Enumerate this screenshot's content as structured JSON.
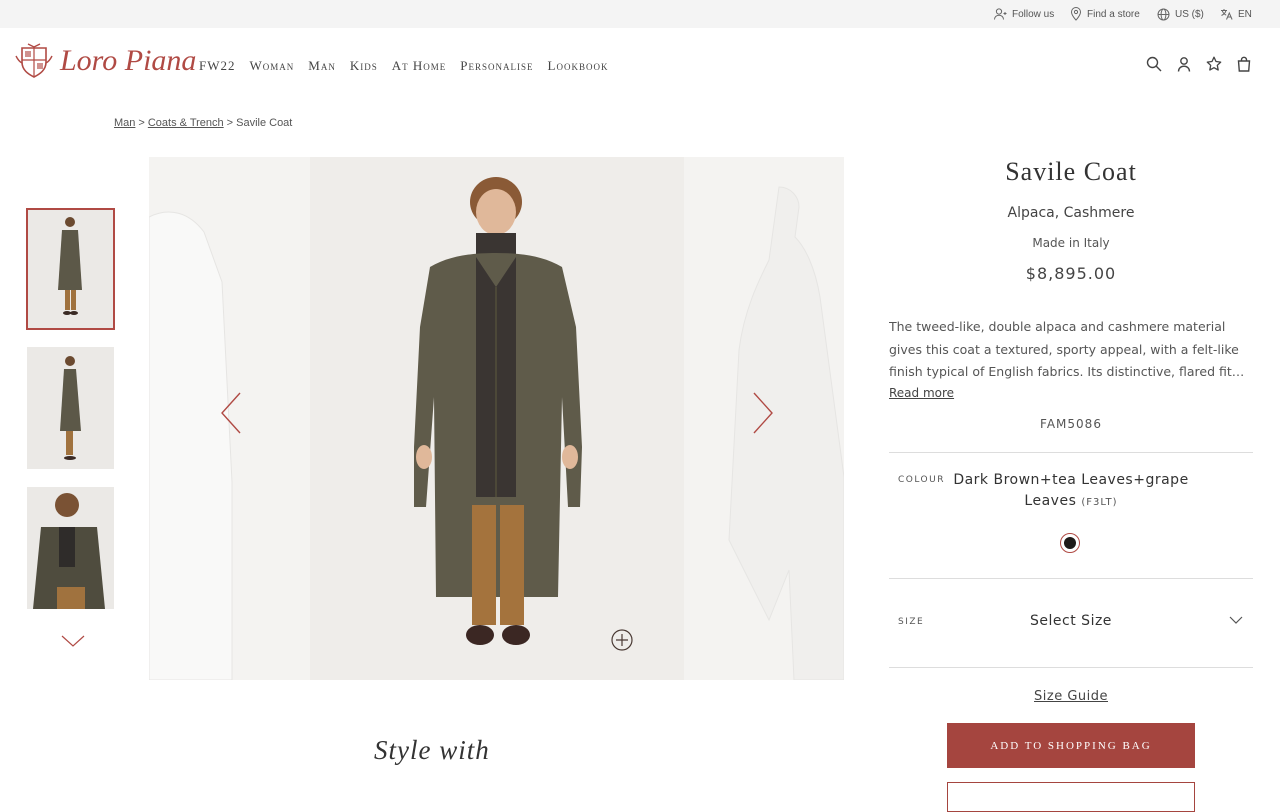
{
  "topbar": {
    "follow_us": "Follow us",
    "find_store": "Find a store",
    "currency": "US ($)",
    "language": "EN"
  },
  "header": {
    "logo_text": "Loro Piana",
    "nav": [
      "FW22",
      "Woman",
      "Man",
      "Kids",
      "At Home",
      "Personalise",
      "Lookbook"
    ],
    "icons": [
      "search-icon",
      "account-icon",
      "wishlist-star-icon",
      "shopping-bag-icon"
    ]
  },
  "breadcrumb": {
    "items": [
      "Man",
      "Coats & Trench"
    ],
    "current": "Savile Coat",
    "separator": ">"
  },
  "product": {
    "title": "Savile Coat",
    "material": "Alpaca, Cashmere",
    "origin": "Made in Italy",
    "price": "$8,895.00",
    "description_lines": [
      "The tweed-like, double alpaca and cashmere material",
      "gives this coat a textured, sporty appeal, with a felt-like",
      "finish typical of English fabrics. Its distinctive, flared fit…"
    ],
    "read_more": "Read more",
    "code": "FAM5086",
    "colour_label": "COLOUR",
    "colour_name_line1": "Dark Brown+tea Leaves+grape",
    "colour_name_line2": "Leaves",
    "colour_code": "(F3LT)",
    "swatch_color": "#1e1a18",
    "size_label": "SIZE",
    "size_value": "Select Size",
    "size_guide": "Size Guide",
    "add_to_bag": "ADD TO SHOPPING BAG"
  },
  "section": {
    "style_with": "Style with"
  },
  "colors": {
    "accent": "#a5453f",
    "topbar_bg": "#f4f4f4"
  }
}
